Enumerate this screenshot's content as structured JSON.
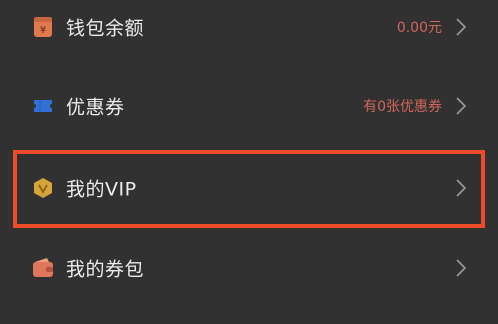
{
  "menu": {
    "items": [
      {
        "id": "wallet",
        "label": "钱包余额",
        "value": "0.00元",
        "icon": "wallet-balance-icon"
      },
      {
        "id": "coupon",
        "label": "优惠券",
        "value": "有0张优惠券",
        "icon": "ticket-icon"
      },
      {
        "id": "vip",
        "label": "我的VIP",
        "value": "",
        "icon": "vip-badge-icon"
      },
      {
        "id": "voucher",
        "label": "我的券包",
        "value": "",
        "icon": "coupon-wallet-icon"
      }
    ]
  },
  "colors": {
    "background": "#313131",
    "label": "#ececec",
    "value": "#d2665a",
    "highlight": "#ee4b2b",
    "chevron": "#9a9a9a"
  }
}
